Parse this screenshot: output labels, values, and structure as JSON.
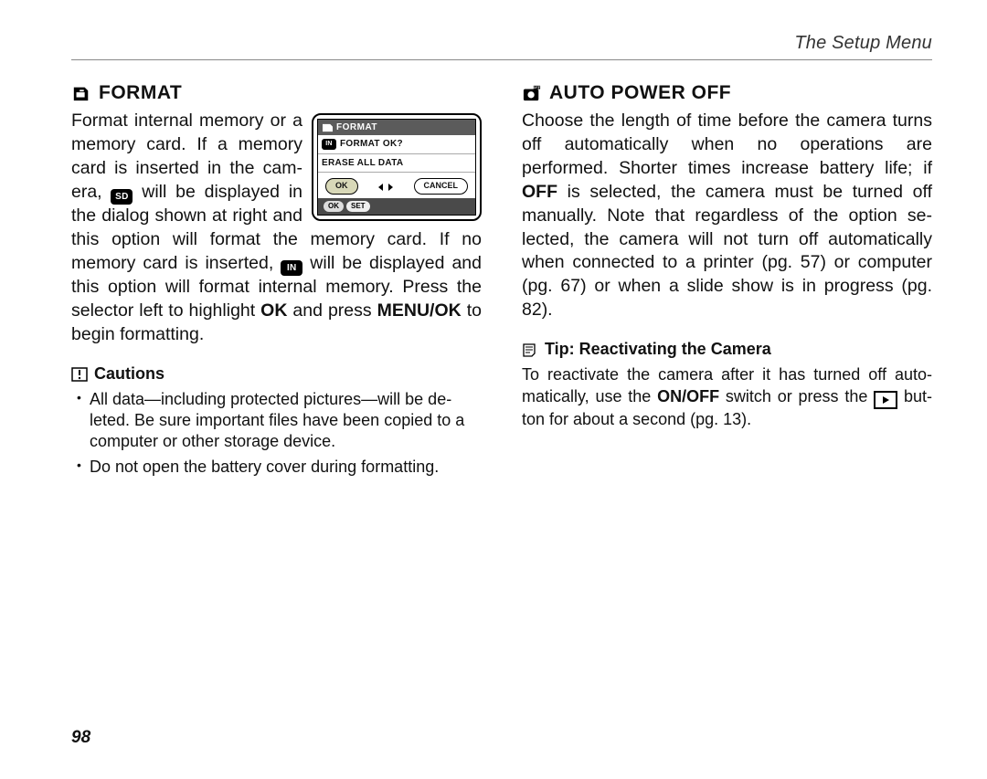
{
  "running_head": "The Setup Menu",
  "page_number": "98",
  "left": {
    "heading": "FORMAT",
    "body_pre": "Format internal memory or a memory card.  If a memory card is inserted in the cam­era, ",
    "sd_label": "SD",
    "body_mid1": " will be displayed in the dialog shown at right and this option will format the memory card.  If no memory card is inserted, ",
    "in_label": "IN",
    "body_mid2": " will be displayed and this option will format internal memory.  Press the selector left to highlight ",
    "ok_word": "OK",
    "body_mid3": " and press ",
    "menuok_word": "MENU/OK",
    "body_end": " to begin formatting.",
    "cautions_title": "Cautions",
    "cautions": [
      "All data—including protected pictures—will be de­leted.  Be sure important files have been copied to a computer or other storage device.",
      "Do not open the battery cover during formatting."
    ],
    "dialog": {
      "title": "FORMAT",
      "line1_icon": "IN",
      "line1": "FORMAT OK?",
      "line2": "ERASE ALL DATA",
      "ok": "OK",
      "cancel": "CANCEL",
      "foot_ok": "OK",
      "foot_set": "SET"
    }
  },
  "right": {
    "heading": "AUTO POWER OFF",
    "body_pre": "Choose the length of time before the camera turns off automatically when no operations are performed.  Shorter times increase battery life; if ",
    "off_word": "OFF",
    "body_end": " is selected, the camera must be turned off manually.  Note that regardless of the option se­lected, the camera will not turn off automatically when connected to a printer (pg. 57) or computer (pg. 67) or when a slide show is in progress (pg. 82).",
    "tip_title": "Tip: Reactivating the Camera",
    "tip_pre": "To reactivate the camera after it has turned off auto­matically, use the ",
    "onoff_word": "ON/OFF",
    "tip_mid": " switch or press the ",
    "tip_end": " but­ton for about a second (pg. 13)."
  }
}
